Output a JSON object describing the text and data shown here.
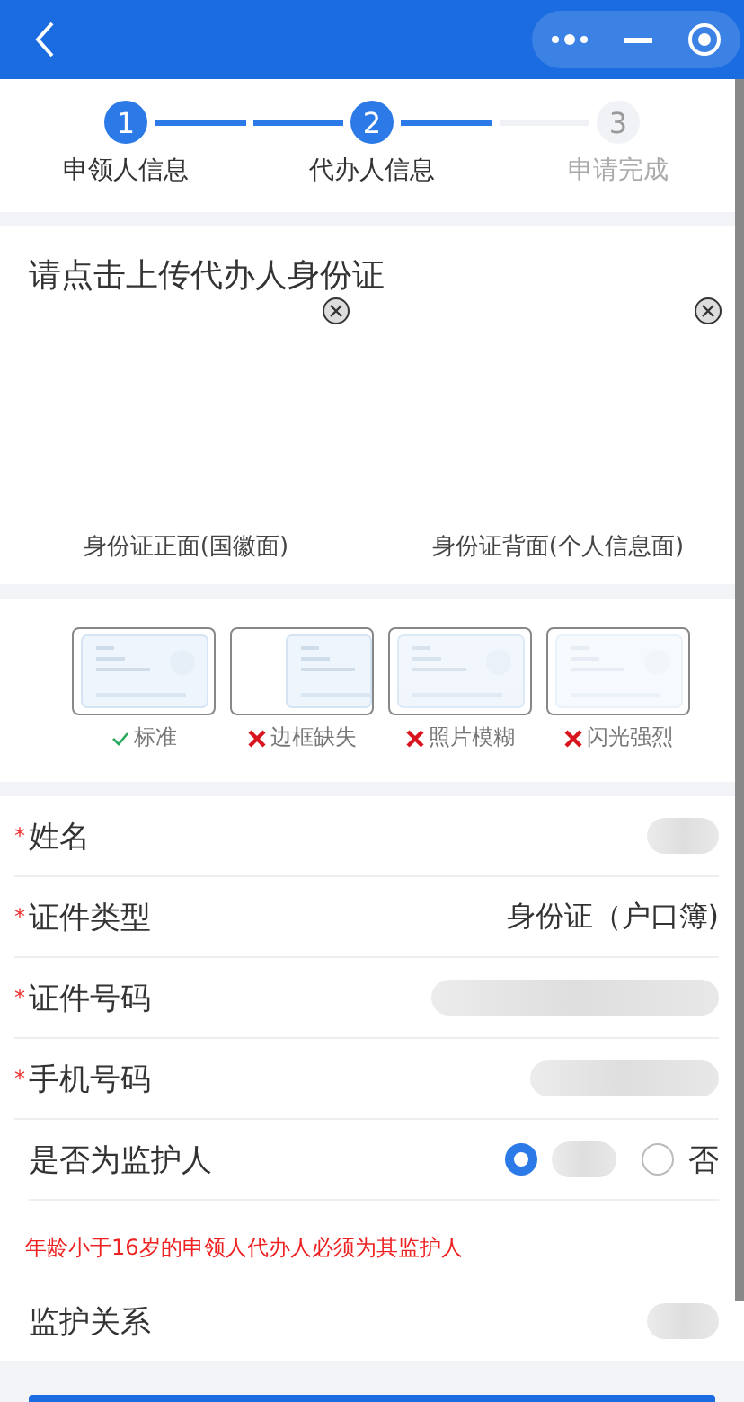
{
  "steps": [
    {
      "number": "1",
      "label": "申领人信息",
      "done": true
    },
    {
      "number": "2",
      "label": "代办人信息",
      "done": true
    },
    {
      "number": "3",
      "label": "申请完成",
      "done": false
    }
  ],
  "upload": {
    "title": "请点击上传代办人身份证",
    "slots": [
      {
        "caption": "身份证正面(国徽面)"
      },
      {
        "caption": "身份证背面(个人信息面)"
      }
    ]
  },
  "guide": [
    {
      "label": "标准",
      "ok": true,
      "kind": "standard"
    },
    {
      "label": "边框缺失",
      "ok": false,
      "kind": "cropped"
    },
    {
      "label": "照片模糊",
      "ok": false,
      "kind": "blurry"
    },
    {
      "label": "闪光强烈",
      "ok": false,
      "kind": "glare"
    }
  ],
  "form": [
    {
      "label": "姓名",
      "marker": "*",
      "kind": "redacted"
    },
    {
      "label": "证件类型",
      "marker": "*",
      "kind": "text",
      "value": "身份证（户口簿)"
    },
    {
      "label": "证件号码",
      "marker": "*",
      "kind": "redacted"
    },
    {
      "label": "手机号码",
      "marker": "*",
      "kind": "redacted"
    },
    {
      "label": "是否为监护人",
      "kind": "radio",
      "options": [
        {
          "selected": true
        },
        {
          "label": "否",
          "selected": false
        }
      ]
    },
    {
      "kind": "warning",
      "text": "年龄小于16岁的申领人代办人必须为其监护人"
    },
    {
      "label": "监护关系",
      "kind": "redacted"
    }
  ]
}
